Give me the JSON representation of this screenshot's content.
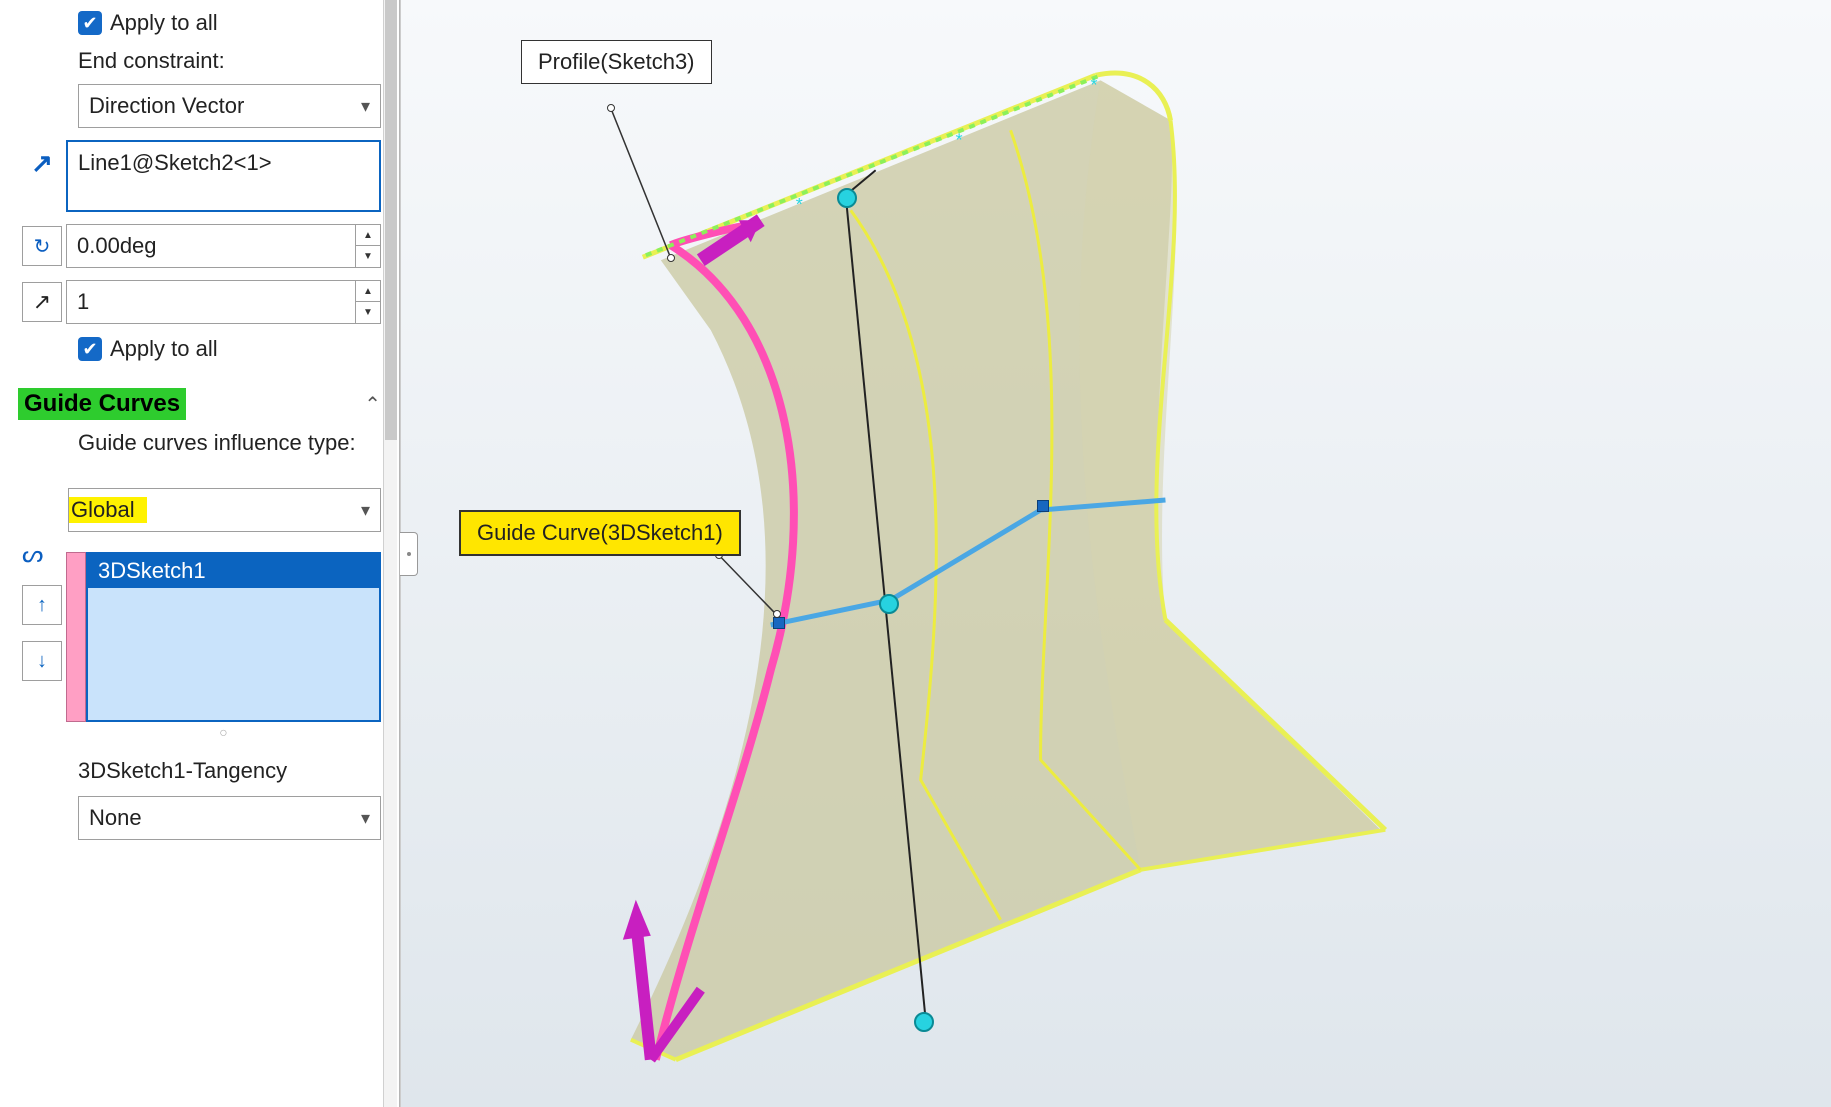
{
  "panel": {
    "apply_to_all_top": "Apply to all",
    "end_constraint_label": "End constraint:",
    "end_constraint_value": "Direction Vector",
    "direction_input": "Line1@Sketch2<1>",
    "angle_value": "0.00deg",
    "scalar_value": "1",
    "apply_to_all_bottom": "Apply to all",
    "guide_curves_title": "Guide Curves",
    "influence_label": "Guide curves influence type:",
    "influence_value": "Global",
    "curve_list": [
      "3DSketch1"
    ],
    "tangency_label": "3DSketch1-Tangency",
    "tangency_value": "None"
  },
  "viewport": {
    "profile_callout": "Profile(Sketch3)",
    "guide_callout": "Guide Curve(3DSketch1)"
  }
}
